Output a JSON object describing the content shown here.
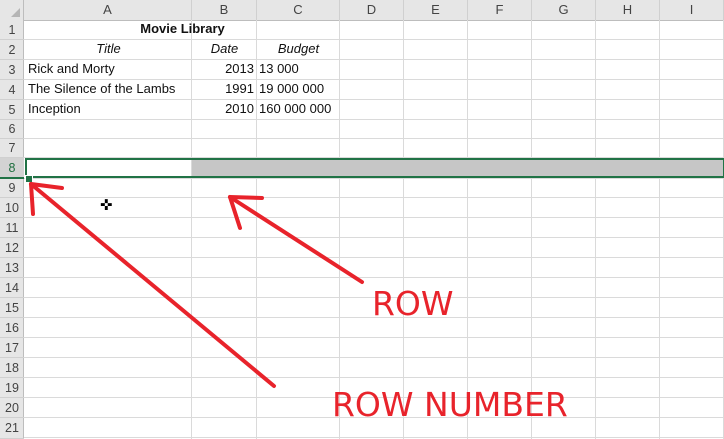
{
  "columns": [
    "A",
    "B",
    "C",
    "D",
    "E",
    "F",
    "G",
    "H",
    "I"
  ],
  "rows": [
    "1",
    "2",
    "3",
    "4",
    "5",
    "6",
    "7",
    "8",
    "9",
    "10",
    "11",
    "12",
    "13",
    "14",
    "15",
    "16",
    "17",
    "18",
    "19",
    "20",
    "21"
  ],
  "selected_row": "8",
  "sheet": {
    "title": "Movie Library",
    "headers": {
      "title": "Title",
      "date": "Date",
      "budget": "Budget"
    },
    "movies": [
      {
        "title": "Rick and Morty",
        "date": "2013",
        "budget": "13 000"
      },
      {
        "title": "The Silence of the Lambs",
        "date": "1991",
        "budget": "19 000 000"
      },
      {
        "title": "Inception",
        "date": "2010",
        "budget": "160 000 000"
      }
    ]
  },
  "annotations": {
    "row": "ROW",
    "row_number": "ROW NUMBER",
    "color": "#e8232b"
  },
  "icons": {
    "cursor": "cell-select-cross-icon"
  }
}
